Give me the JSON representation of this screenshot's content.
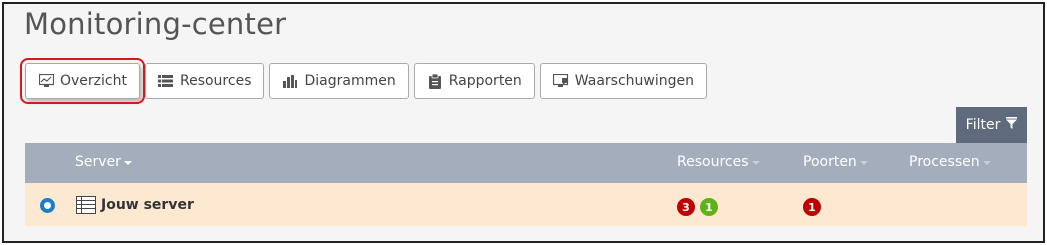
{
  "page": {
    "title": "Monitoring-center"
  },
  "tabs": [
    {
      "label": "Overzicht",
      "icon": "monitor-chart-icon"
    },
    {
      "label": "Resources",
      "icon": "list-icon"
    },
    {
      "label": "Diagrammen",
      "icon": "bar-chart-icon"
    },
    {
      "label": "Rapporten",
      "icon": "clipboard-icon"
    },
    {
      "label": "Waarschuwingen",
      "icon": "monitor-alert-icon"
    }
  ],
  "filter": {
    "label": "Filter",
    "icon": "filter-icon"
  },
  "table": {
    "headers": {
      "server": "Server",
      "resources": "Resources",
      "poorten": "Poorten",
      "processen": "Processen"
    },
    "rows": [
      {
        "name": "Jouw server",
        "resources_badges": [
          {
            "value": "3",
            "color": "#c00000"
          },
          {
            "value": "1",
            "color": "#5fb219"
          }
        ],
        "poorten_badges": [
          {
            "value": "1",
            "color": "#c00000"
          }
        ]
      }
    ]
  },
  "colors": {
    "accent": "#1a7ccc",
    "header": "#a3adbc",
    "row_highlight": "#fde8d2",
    "filter_bg": "#5f6b7c"
  }
}
